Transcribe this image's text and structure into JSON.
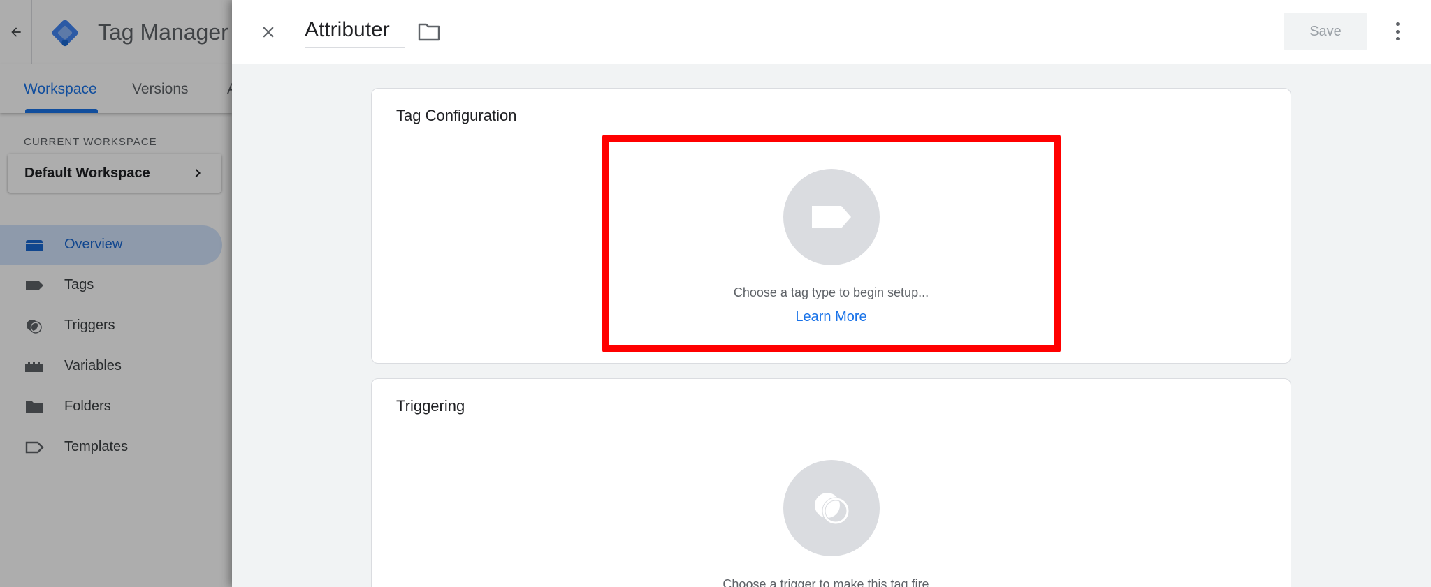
{
  "app": {
    "title": "Tag Manager",
    "tabs": [
      {
        "label": "Workspace",
        "active": true
      },
      {
        "label": "Versions",
        "active": false
      },
      {
        "label": "A",
        "active": false
      }
    ],
    "current_workspace_label": "CURRENT WORKSPACE",
    "workspace_name": "Default Workspace",
    "sidebar": [
      {
        "label": "Overview",
        "icon": "overview-icon",
        "active": true
      },
      {
        "label": "Tags",
        "icon": "tag-icon",
        "active": false
      },
      {
        "label": "Triggers",
        "icon": "trigger-icon",
        "active": false
      },
      {
        "label": "Variables",
        "icon": "variables-icon",
        "active": false
      },
      {
        "label": "Folders",
        "icon": "folder-icon",
        "active": false
      },
      {
        "label": "Templates",
        "icon": "template-icon",
        "active": false
      }
    ]
  },
  "panel": {
    "tag_name": "Attributer",
    "save_label": "Save",
    "tag_configuration": {
      "title": "Tag Configuration",
      "hint": "Choose a tag type to begin setup...",
      "learn_more": "Learn More"
    },
    "triggering": {
      "title": "Triggering",
      "hint": "Choose a trigger to make this tag fire..."
    }
  },
  "colors": {
    "accent": "#1a73e8",
    "highlight": "#ff0000",
    "panel_bg": "#f1f3f4",
    "placeholder_circle": "#dadce0"
  }
}
